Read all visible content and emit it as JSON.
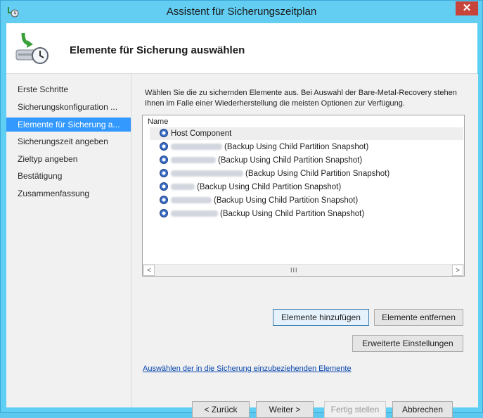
{
  "window": {
    "title": "Assistent für Sicherungszeitplan",
    "close_glyph": "✕"
  },
  "header": {
    "title": "Elemente für Sicherung auswählen",
    "icon": "backup-schedule-icon"
  },
  "sidebar": {
    "items": [
      {
        "label": "Erste Schritte"
      },
      {
        "label": "Sicherungskonfiguration ..."
      },
      {
        "label": "Elemente für Sicherung a...",
        "selected": true
      },
      {
        "label": "Sicherungszeit angeben"
      },
      {
        "label": "Zieltyp angeben"
      },
      {
        "label": "Bestätigung"
      },
      {
        "label": "Zusammenfassung"
      }
    ]
  },
  "content": {
    "description": "Wählen Sie die zu sichernden Elemente aus. Bei Auswahl der Bare-Metal-Recovery stehen Ihnen im Falle einer Wiederherstellung die meisten Optionen zur Verfügung.",
    "list_header": "Name",
    "items": [
      {
        "label": "Host Component"
      },
      {
        "label": "(Backup Using Child Partition Snapshot)"
      },
      {
        "label": "(Backup Using Child Partition Snapshot)"
      },
      {
        "label": "(Backup Using Child Partition Snapshot)"
      },
      {
        "label": "(Backup Using Child Partition Snapshot)"
      },
      {
        "label": "(Backup Using Child Partition Snapshot)"
      },
      {
        "label": "(Backup Using Child Partition Snapshot)"
      }
    ],
    "scroll_left": "<",
    "scroll_right": ">",
    "scroll_thumb": "III",
    "add_button": "Elemente hinzufügen",
    "remove_button": "Elemente entfernen",
    "advanced_button": "Erweiterte Einstellungen",
    "link": "Auswählen der in die Sicherung einzubeziehenden Elemente"
  },
  "footer": {
    "back": "< Zurück",
    "next": "Weiter >",
    "finish": "Fertig stellen",
    "cancel": "Abbrechen"
  }
}
